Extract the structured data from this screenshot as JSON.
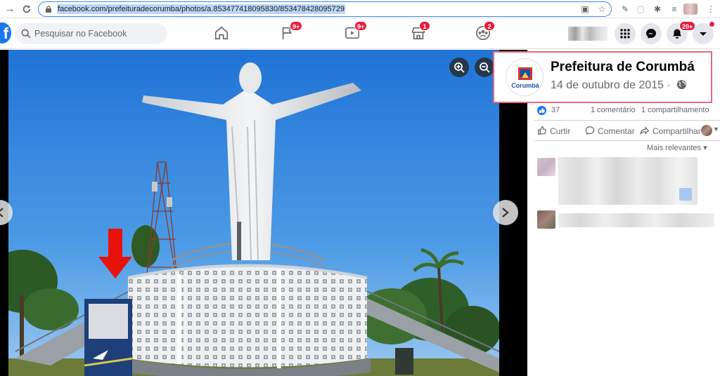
{
  "browser": {
    "url": "facebook.com/prefeituradecorumba/photos/a.853477418095830/853478428095729"
  },
  "facebook": {
    "logo": "f",
    "search_placeholder": "Pesquisar no Facebook",
    "tabs": [
      {
        "icon": "home-icon",
        "badge": ""
      },
      {
        "icon": "flag-icon",
        "badge": "9+"
      },
      {
        "icon": "watch-icon",
        "badge": "9+"
      },
      {
        "icon": "marketplace-icon",
        "badge": "1"
      },
      {
        "icon": "groups-icon",
        "badge": "2"
      }
    ],
    "notifications_badge": "20+"
  },
  "post": {
    "page_name": "Prefeitura de Corumbá",
    "date": "14 de outubro de 2015 ·",
    "logo_text": "Corumbá",
    "likes": "37",
    "comments": "1 comentário",
    "shares": "1 compartilhamento",
    "actions": {
      "like": "Curtir",
      "comment": "Comentar",
      "share": "Compartilhar"
    },
    "sort_label": "Mais relevantes"
  },
  "colors": {
    "fb_blue": "#1877f2",
    "badge_red": "#e41e3f",
    "highlight_border": "#e26a7f",
    "annotation_arrow": "#e8120c"
  }
}
